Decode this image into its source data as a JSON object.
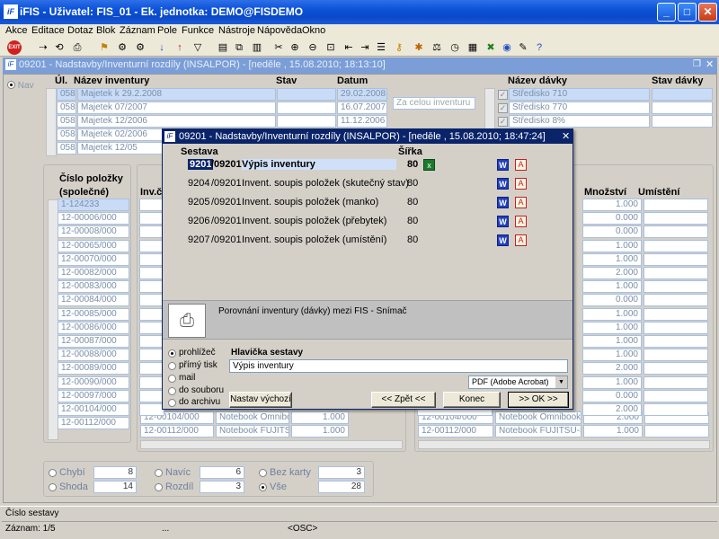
{
  "window": {
    "title": "iFIS - Uživatel: FIS_01 - Ek. jednotka: DEMO@FISDEMO"
  },
  "menu": [
    "Akce",
    "Editace",
    "Dotaz",
    "Blok",
    "Záznam",
    "Pole",
    "Funkce",
    "Nástroje",
    "Nápověda",
    "Okno"
  ],
  "toolbar": {
    "exit_label": "EXIT"
  },
  "inner": {
    "title": "09201 - Nadstavby/Inventurní rozdíly (INSALPOR) - [neděle , 15.08.2010; 18:13:10]",
    "nav_label": "Nav",
    "headers": {
      "ul": "Úl.",
      "nazev": "Název inventury",
      "stav": "Stav",
      "datum": "Datum",
      "nazev_davky": "Název dávky",
      "stav_davky": "Stav dávky"
    },
    "inventories": [
      {
        "ul": "058",
        "name": "Majetek k 29.2.2008",
        "date": "29.02.2008"
      },
      {
        "ul": "058",
        "name": "Majetek 07/2007",
        "date": "16.07.2007"
      },
      {
        "ul": "058",
        "name": "Majetek 12/2006",
        "date": "11.12.2006"
      },
      {
        "ul": "058",
        "name": "Majetek 02/2006",
        "date": ""
      },
      {
        "ul": "058",
        "name": "Majetek 12/05",
        "date": ""
      }
    ],
    "filter_select": "Za celou inventuru",
    "batches": [
      "Středisko 710",
      "Středisko 770",
      "Středisko 8%"
    ],
    "item_header": "Číslo položky (společné)",
    "items": [
      "1-124233",
      "12-00006/000",
      "12-00008/000",
      "12-00065/000",
      "12-00070/000",
      "12-00082/000",
      "12-00083/000",
      "12-00084/000",
      "12-00085/000",
      "12-00086/000",
      "12-00087/000",
      "12-00088/000",
      "12-00089/000",
      "12-00090/000",
      "12-00097/000",
      "12-00104/000",
      "12-00112/000"
    ],
    "mid_header": "Inv.čí",
    "right_headers": {
      "mnozstvi": "Množství",
      "umisteni": "Umístění"
    },
    "right_qty": [
      "1.000",
      "0.000",
      "0.000",
      "1.000",
      "1.000",
      "2.000",
      "1.000",
      "0.000",
      "1.000",
      "1.000",
      "1.000",
      "1.000",
      "2.000",
      "1.000",
      "0.000",
      "2.000",
      "1.000"
    ],
    "mid_bottom": [
      {
        "code": "12-00104/000",
        "name": "Notebook Omnibook",
        "qty": "1.000"
      },
      {
        "code": "12-00112/000",
        "name": "Notebook FUJITSU-Si",
        "qty": "1.000"
      }
    ],
    "right_bottom": [
      {
        "code": "12-00104/000",
        "name": "Notebook Omnibook",
        "qty": "2.000"
      },
      {
        "code": "12-00112/000",
        "name": "Notebook FUJITSU-Sie",
        "qty": "1.000"
      }
    ],
    "counters": [
      {
        "label": "Chybí",
        "value": "8"
      },
      {
        "label": "Navíc",
        "value": "6"
      },
      {
        "label": "Bez karty",
        "value": "3"
      },
      {
        "label": "Shoda",
        "value": "14"
      },
      {
        "label": "Rozdíl",
        "value": "3"
      },
      {
        "label": "Vše",
        "value": "28"
      }
    ]
  },
  "dialog": {
    "title": "09201 - Nadstavby/Inventurní rozdíly (INSALPOR) - [neděle , 15.08.2010; 18:47:24]",
    "col_sestava": "Sestava",
    "col_sirka": "Šířka",
    "reports": [
      {
        "code_a": "9201",
        "code_b": "/09201",
        "name": "Výpis inventury",
        "width": "80"
      },
      {
        "code_a": "9204",
        "code_b": "/09201",
        "name": "Invent. soupis položek (skutečný stav)",
        "width": "80"
      },
      {
        "code_a": "9205",
        "code_b": "/09201",
        "name": "Invent. soupis položek (manko)",
        "width": "80"
      },
      {
        "code_a": "9206",
        "code_b": "/09201",
        "name": "Invent. soupis položek (přebytek)",
        "width": "80"
      },
      {
        "code_a": "9207",
        "code_b": "/09201",
        "name": "Invent. soupis položek (umístění)",
        "width": "80"
      }
    ],
    "description": "Porovnání inventury (dávky) mezi FIS - Snímač",
    "outputs": [
      "prohlížeč",
      "přímý tisk",
      "mail",
      "do souboru",
      "do archivu"
    ],
    "header_label": "Hlavička sestavy",
    "header_value": "Výpis inventury",
    "format": "PDF (Adobe Acrobat)",
    "btn_defaults": "Nastav výchozí",
    "btn_back": "<< Zpět <<",
    "btn_close": "Konec",
    "btn_ok": ">> OK >>"
  },
  "status": {
    "field": "Číslo sestavy",
    "record": "Záznam: 1/5",
    "dots": "...",
    "osc": "<OSC>"
  }
}
